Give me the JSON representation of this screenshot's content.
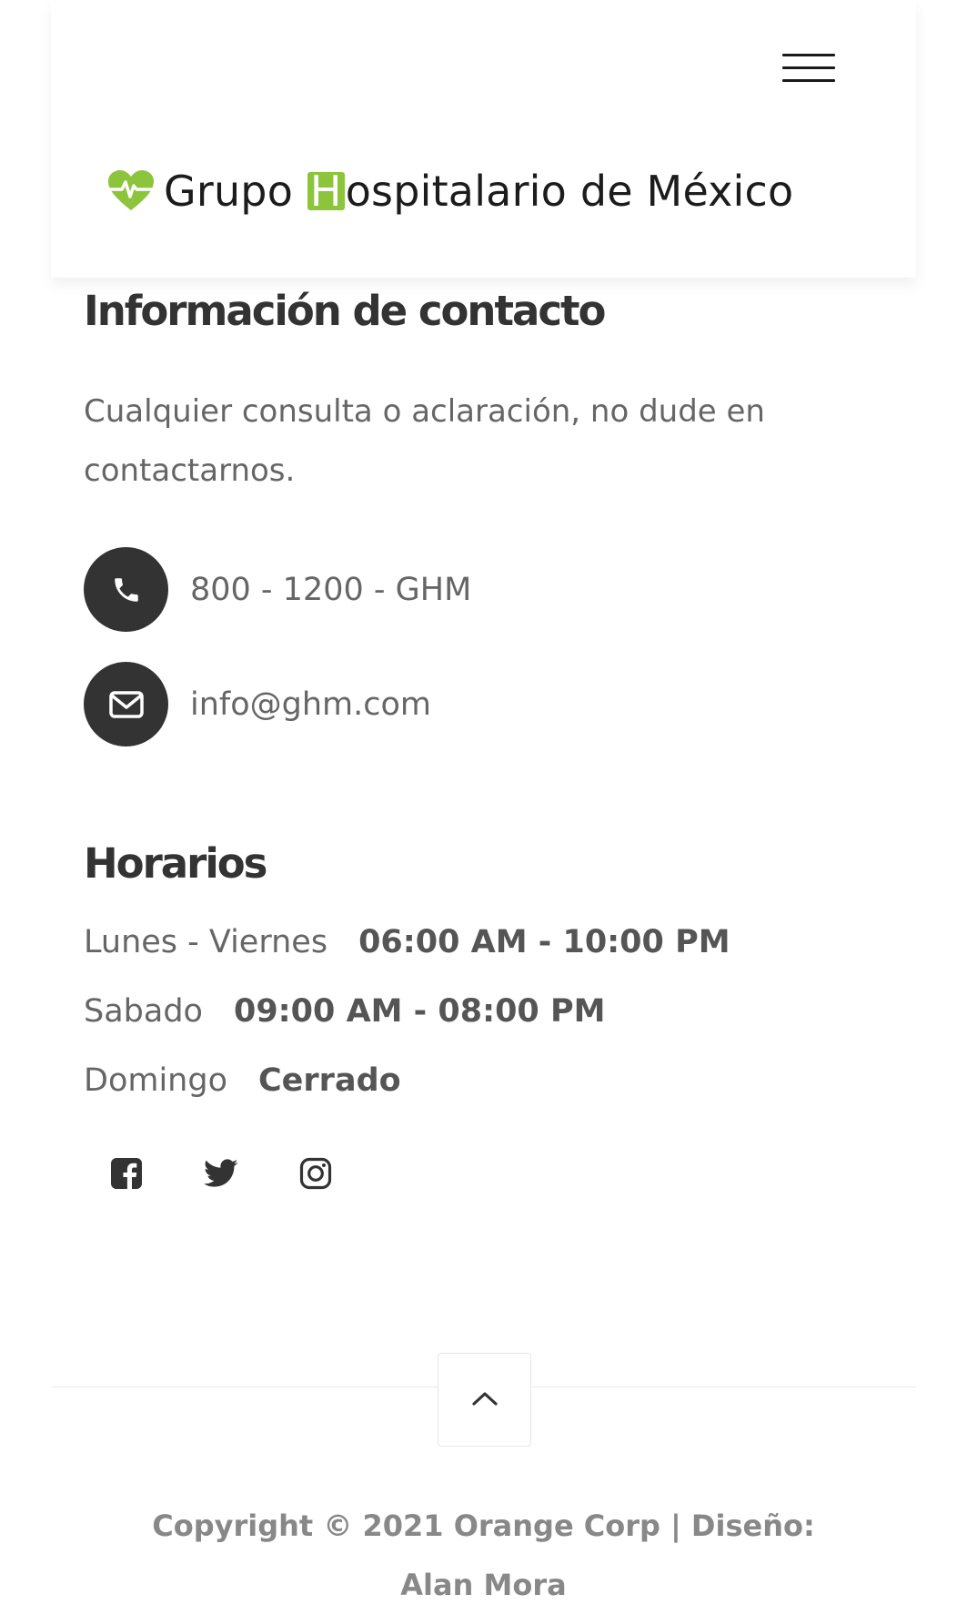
{
  "header": {
    "menu_icon": "hamburger-menu-icon",
    "brand": {
      "logo_icon": "heartbeat-icon",
      "text_before": "Grupo ",
      "highlight_letter": "H",
      "text_after": "ospitalario de México",
      "accent_color": "#8cc43c"
    }
  },
  "contact": {
    "title": "Información de contacto",
    "description": "Cualquier consulta o aclaración, no dude en contactarnos.",
    "phone": {
      "icon": "phone-icon",
      "text": "800 - 1200 - GHM"
    },
    "email": {
      "icon": "envelope-icon",
      "text": "info@ghm.com"
    }
  },
  "hours": {
    "title": "Horarios",
    "rows": [
      {
        "day": "Lunes - Viernes",
        "time": "06:00 AM - 10:00 PM"
      },
      {
        "day": "Sabado",
        "time": "09:00 AM - 08:00 PM"
      },
      {
        "day": "Domingo",
        "time": "Cerrado"
      }
    ]
  },
  "social": [
    {
      "icon": "facebook-icon"
    },
    {
      "icon": "twitter-icon"
    },
    {
      "icon": "instagram-icon"
    }
  ],
  "footer": {
    "back_to_top_icon": "chevron-up-icon",
    "copyright": "Copyright © 2021 Orange Corp | Diseño: Alan Mora"
  },
  "colors": {
    "dark_circle": "#333333",
    "body_text": "#666666",
    "heading_text": "#333333"
  }
}
